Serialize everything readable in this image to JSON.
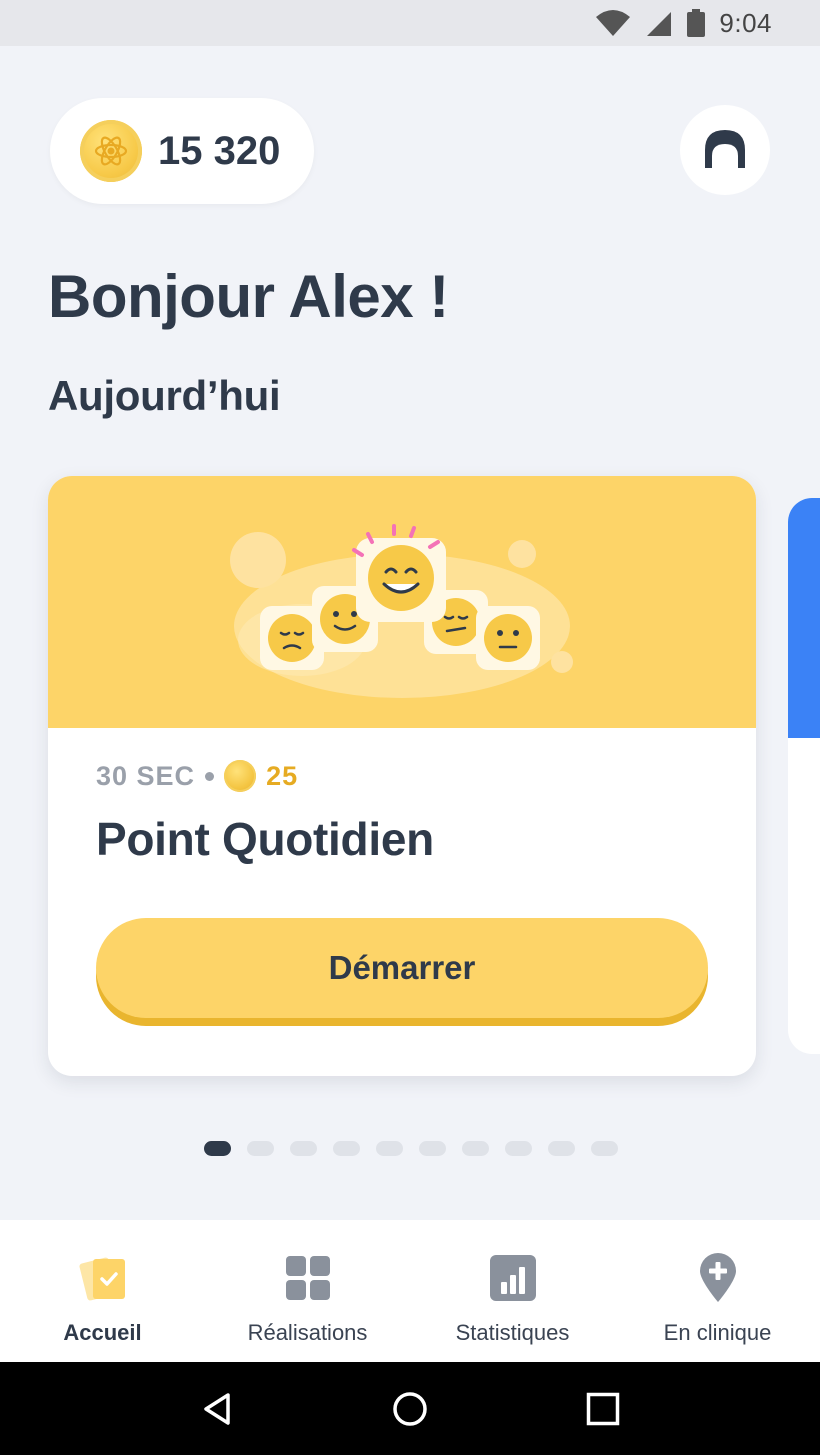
{
  "status_bar": {
    "time": "9:04"
  },
  "header": {
    "coins": "15 320"
  },
  "greeting": "Bonjour Alex !",
  "section_title": "Aujourd’hui",
  "card": {
    "duration": "30 SEC",
    "reward": "25",
    "title": "Point Quotidien",
    "button_label": "Démarrer"
  },
  "pager": {
    "total": 10,
    "active_index": 0
  },
  "bottom_nav": [
    {
      "label": "Accueil",
      "icon": "home-cards-icon",
      "active": true
    },
    {
      "label": "Réalisations",
      "icon": "achievements-grid-icon",
      "active": false
    },
    {
      "label": "Statistiques",
      "icon": "stats-chart-icon",
      "active": false
    },
    {
      "label": "En clinique",
      "icon": "clinic-location-icon",
      "active": false
    }
  ],
  "colors": {
    "accent_yellow": "#fdd468",
    "accent_yellow_dark": "#e9b52e",
    "text_dark": "#2f3a4a",
    "next_card_blue": "#3b82f6",
    "background": "#f1f3f8"
  }
}
